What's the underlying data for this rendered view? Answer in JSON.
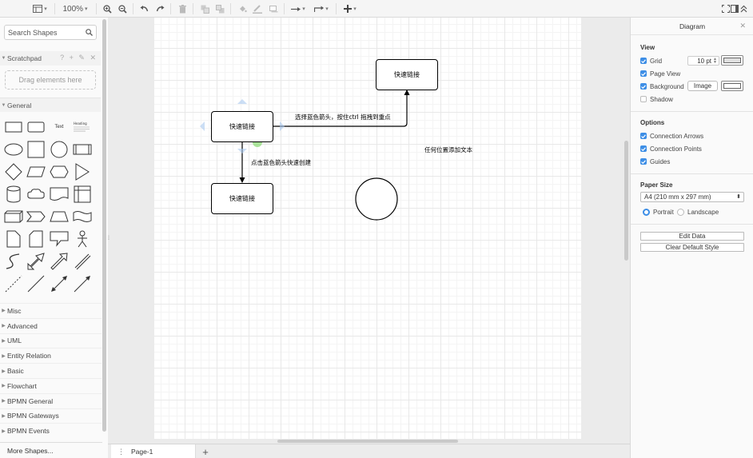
{
  "toolbar": {
    "zoom": "100%"
  },
  "sidebar": {
    "search_placeholder": "Search Shapes",
    "scratchpad_label": "Scratchpad",
    "scratchpad_actions": "? + ✎ ✕",
    "dropzone_text": "Drag elements here",
    "general_label": "General",
    "text_shape_label": "Text",
    "heading_shape_label": "Heading",
    "groups": [
      "Misc",
      "Advanced",
      "UML",
      "Entity Relation",
      "Basic",
      "Flowchart",
      "BPMN General",
      "BPMN Gateways",
      "BPMN Events"
    ],
    "more_shapes": "More Shapes..."
  },
  "diagram": {
    "node_a": "快速链接",
    "node_b": "快速链接",
    "node_c": "快速链接",
    "edge_label_right": "选择蓝色箭头，按住ctrl 拖拽到重点",
    "edge_label_down": "点击蓝色箭头快速创建",
    "free_text": "任何位置添加文本"
  },
  "bottom": {
    "page_tab": "Page-1",
    "add_page": "+"
  },
  "panel": {
    "title": "Diagram",
    "close": "✕",
    "view_heading": "View",
    "grid_label": "Grid",
    "grid_size": "10 pt",
    "page_view_label": "Page View",
    "background_label": "Background",
    "image_button": "Image",
    "shadow_label": "Shadow",
    "options_heading": "Options",
    "connection_arrows_label": "Connection Arrows",
    "connection_points_label": "Connection Points",
    "guides_label": "Guides",
    "paper_size_heading": "Paper Size",
    "paper_size_value": "A4 (210 mm x 297 mm)",
    "portrait_label": "Portrait",
    "landscape_label": "Landscape",
    "edit_data_button": "Edit Data",
    "clear_style_button": "Clear Default Style"
  },
  "colors": {
    "accent": "#3d8ee6",
    "selection_handles": "#a9c8ef",
    "hover_dot": "#8fdb7a"
  }
}
